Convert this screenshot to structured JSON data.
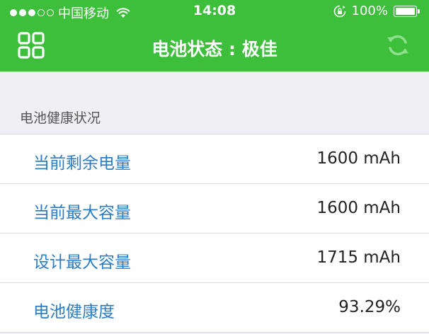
{
  "status_bar": {
    "carrier": "中国移动",
    "time": "14:08",
    "battery_percent": "100%",
    "battery_level": 1.0,
    "signal_bars_filled": 3,
    "signal_bars_total": 5
  },
  "nav": {
    "title": "电池状态 : 极佳",
    "menu_icon": "grid-icon",
    "refresh_icon": "refresh-icon"
  },
  "section": {
    "title": "电池健康状况"
  },
  "battery_rows": [
    {
      "label": "当前剩余电量",
      "value": "1600 mAh"
    },
    {
      "label": "当前最大容量",
      "value": "1600 mAh"
    },
    {
      "label": "设计最大容量",
      "value": "1715 mAh"
    },
    {
      "label": "电池健康度",
      "value": "93.29%"
    }
  ],
  "colors": {
    "header_bg": "#3dbf3c",
    "label_color": "#2b7dc4",
    "page_bg": "#efeff4"
  }
}
